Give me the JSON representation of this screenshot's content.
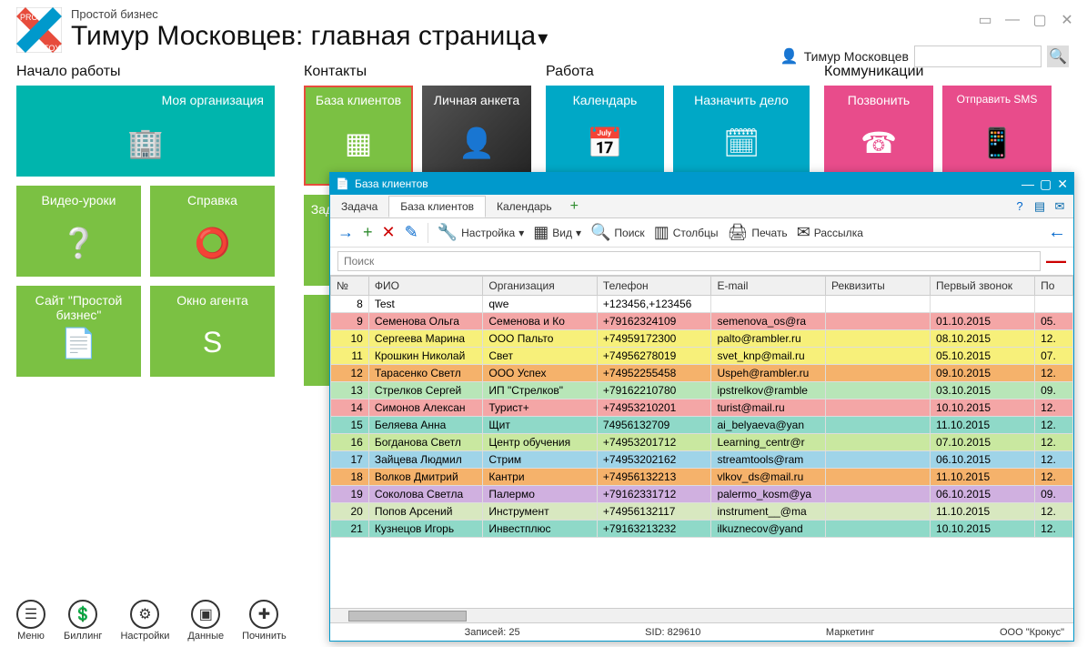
{
  "header": {
    "small_title": "Простой бизнес",
    "big_title": "Тимур Московцев: главная страница",
    "user_name": "Тимур Московцев"
  },
  "sections": {
    "s1": {
      "title": "Начало работы",
      "my_org": "Моя организация",
      "video": "Видео-уроки",
      "help": "Справка",
      "site": "Сайт \"Простой бизнес\"",
      "agent": "Окно агента"
    },
    "s2": {
      "title": "Контакты",
      "clients": "База клиентов",
      "profile": "Личная анкета",
      "task_partial": "Зад"
    },
    "s3": {
      "title": "Работа",
      "calendar": "Календарь",
      "assign": "Назначить дело"
    },
    "s4": {
      "title": "Коммуникации",
      "call": "Позвонить",
      "sms": "Отправить SMS"
    }
  },
  "bottom": {
    "menu": "Меню",
    "billing": "Биллинг",
    "settings": "Настройки",
    "data": "Данные",
    "fix": "Починить"
  },
  "popup": {
    "title": "База клиентов",
    "tabs": {
      "task": "Задача",
      "clients": "База клиентов",
      "calendar": "Календарь"
    },
    "toolbar": {
      "settings": "Настройка",
      "view": "Вид",
      "search": "Поиск",
      "columns": "Столбцы",
      "print": "Печать",
      "mailing": "Рассылка"
    },
    "search_placeholder": "Поиск",
    "columns": {
      "num": "№",
      "fio": "ФИО",
      "org": "Организация",
      "phone": "Телефон",
      "email": "E-mail",
      "req": "Реквизиты",
      "first_call": "Первый звонок",
      "last": "По"
    },
    "rows": [
      {
        "n": "8",
        "fio": "Test",
        "org": "qwe",
        "phone": "+123456,+123456",
        "email": "",
        "req": "",
        "call": "",
        "last": "",
        "c": "r-white"
      },
      {
        "n": "9",
        "fio": "Семенова Ольга",
        "org": "Семенова и Ко",
        "phone": "+79162324109",
        "email": "semenova_os@ra",
        "req": "",
        "call": "01.10.2015",
        "last": "05.",
        "c": "r-pink"
      },
      {
        "n": "10",
        "fio": "Сергеева Марина",
        "org": "ООО Пальто",
        "phone": "+74959172300",
        "email": "palto@rambler.ru",
        "req": "",
        "call": "08.10.2015",
        "last": "12.",
        "c": "r-yellow"
      },
      {
        "n": "11",
        "fio": "Крошкин Николай",
        "org": "Свет",
        "phone": "+74956278019",
        "email": "svet_knp@mail.ru",
        "req": "",
        "call": "05.10.2015",
        "last": "07.",
        "c": "r-yellow"
      },
      {
        "n": "12",
        "fio": "Тарасенко Светл",
        "org": "ООО Успех",
        "phone": "+74952255458",
        "email": "Uspeh@rambler.ru",
        "req": "",
        "call": "09.10.2015",
        "last": "12.",
        "c": "r-orange"
      },
      {
        "n": "13",
        "fio": "Стрелков Сергей",
        "org": "ИП \"Стрелков\"",
        "phone": "+79162210780",
        "email": "ipstrelkov@ramble",
        "req": "",
        "call": "03.10.2015",
        "last": "09.",
        "c": "r-lgreen"
      },
      {
        "n": "14",
        "fio": "Симонов Алексан",
        "org": "Турист+",
        "phone": "+74953210201",
        "email": "turist@mail.ru",
        "req": "",
        "call": "10.10.2015",
        "last": "12.",
        "c": "r-pink"
      },
      {
        "n": "15",
        "fio": "Беляева Анна",
        "org": "Щит",
        "phone": "74956132709",
        "email": "ai_belyaeva@yan",
        "req": "",
        "call": "11.10.2015",
        "last": "12.",
        "c": "r-teal"
      },
      {
        "n": "16",
        "fio": "Богданова Светл",
        "org": "Центр обучения",
        "phone": "+74953201712",
        "email": "Learning_centr@r",
        "req": "",
        "call": "07.10.2015",
        "last": "12.",
        "c": "r-lgreen2"
      },
      {
        "n": "17",
        "fio": "Зайцева Людмил",
        "org": "Стрим",
        "phone": "+74953202162",
        "email": "streamtools@ram",
        "req": "",
        "call": "06.10.2015",
        "last": "12.",
        "c": "r-blue"
      },
      {
        "n": "18",
        "fio": "Волков Дмитрий",
        "org": "Кантри",
        "phone": "+74956132213",
        "email": "vlkov_ds@mail.ru",
        "req": "",
        "call": "11.10.2015",
        "last": "12.",
        "c": "r-orange"
      },
      {
        "n": "19",
        "fio": "Соколова Светла",
        "org": "Палермо",
        "phone": "+79162331712",
        "email": "palermo_kosm@ya",
        "req": "",
        "call": "06.10.2015",
        "last": "09.",
        "c": "r-purple"
      },
      {
        "n": "20",
        "fio": "Попов Арсений",
        "org": "Инструмент",
        "phone": "+74956132117",
        "email": "instrument__@ma",
        "req": "",
        "call": "11.10.2015",
        "last": "12.",
        "c": "r-pale"
      },
      {
        "n": "21",
        "fio": "Кузнецов Игорь",
        "org": "Инвестплюс",
        "phone": "+79163213232",
        "email": "ilkuznecov@yand",
        "req": "",
        "call": "10.10.2015",
        "last": "12.",
        "c": "r-teal"
      }
    ],
    "status": {
      "records": "Записей: 25",
      "sid": "SID: 829610",
      "dept": "Маркетинг",
      "company": "ООО \"Крокус\""
    }
  }
}
